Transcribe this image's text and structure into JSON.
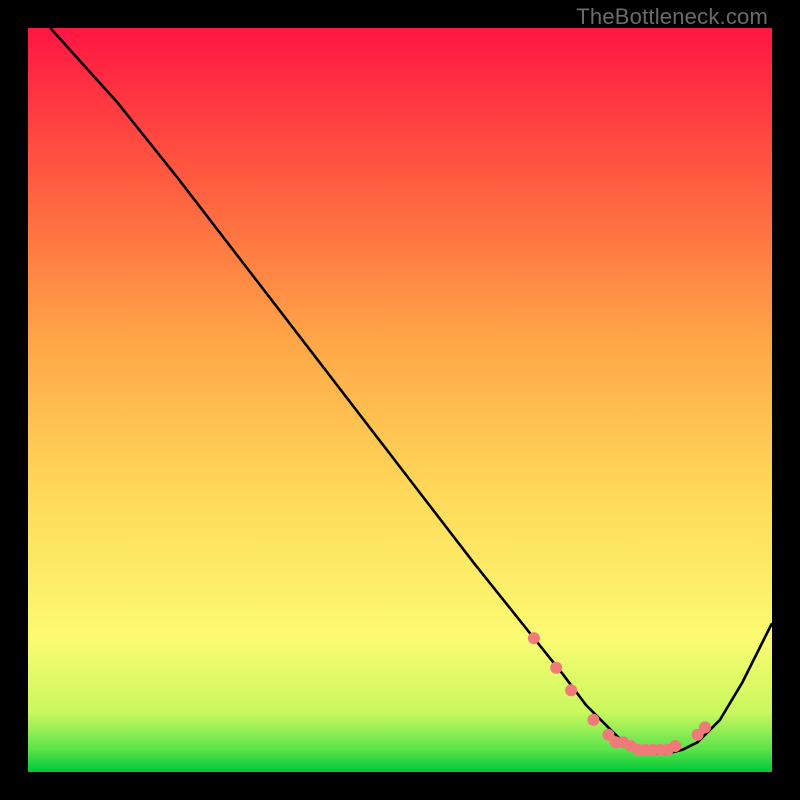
{
  "watermark": "TheBottleneck.com",
  "chart_data": {
    "type": "line",
    "title": "",
    "xlabel": "",
    "ylabel": "",
    "xlim": [
      0,
      100
    ],
    "ylim": [
      0,
      100
    ],
    "grid": false,
    "legend": false,
    "gradient_stops": [
      {
        "offset": 0.0,
        "color": "#00c738"
      },
      {
        "offset": 0.03,
        "color": "#5be34a"
      },
      {
        "offset": 0.08,
        "color": "#c9f85e"
      },
      {
        "offset": 0.18,
        "color": "#fbfb72"
      },
      {
        "offset": 0.38,
        "color": "#ffd859"
      },
      {
        "offset": 0.58,
        "color": "#ffa647"
      },
      {
        "offset": 0.8,
        "color": "#ff5a3f"
      },
      {
        "offset": 1.0,
        "color": "#ff1643"
      }
    ],
    "series": [
      {
        "name": "bottleneck-curve",
        "x": [
          3,
          12,
          20,
          30,
          40,
          50,
          60,
          68,
          72,
          75,
          78,
          80,
          82,
          84,
          86,
          88,
          90,
          93,
          96,
          100
        ],
        "values": [
          100,
          90,
          80,
          67,
          54,
          41,
          28,
          18,
          13,
          9,
          6,
          4,
          3,
          2.5,
          2.5,
          3,
          4,
          7,
          12,
          20
        ]
      }
    ],
    "markers": {
      "name": "highlight-points",
      "color": "#f07a78",
      "radius": 6,
      "x": [
        68,
        71,
        73,
        76,
        78,
        79,
        80,
        81,
        82,
        83,
        84,
        85,
        86,
        87,
        90,
        91
      ],
      "values": [
        18,
        14,
        11,
        7,
        5,
        4,
        4,
        3.5,
        3,
        3,
        3,
        3,
        3,
        3.5,
        5,
        6
      ]
    }
  }
}
